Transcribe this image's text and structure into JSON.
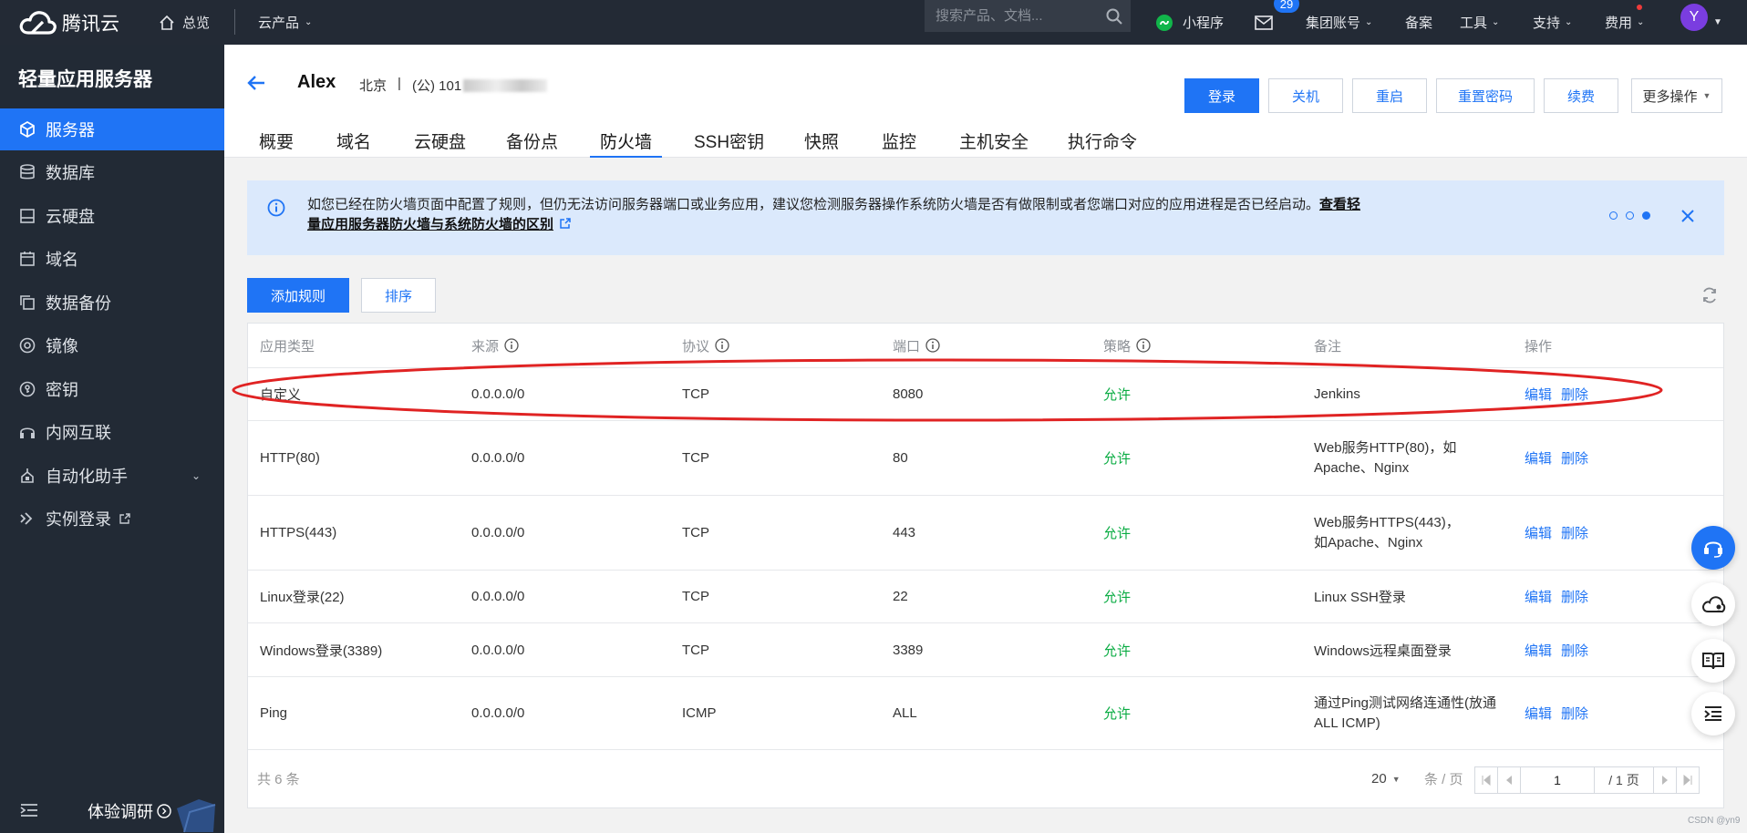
{
  "topbar": {
    "logo": "腾讯云",
    "overview": "总览",
    "products": "云产品",
    "search_placeholder": "搜索产品、文档...",
    "mini_program": "小程序",
    "mail_badge": "29",
    "group_account": "集团账号",
    "filing": "备案",
    "tools": "工具",
    "support": "支持",
    "billing": "费用",
    "avatar": "Y"
  },
  "sidebar": {
    "title": "轻量应用服务器",
    "items": [
      {
        "label": "服务器"
      },
      {
        "label": "数据库"
      },
      {
        "label": "云硬盘"
      },
      {
        "label": "域名"
      },
      {
        "label": "数据备份"
      },
      {
        "label": "镜像"
      },
      {
        "label": "密钥"
      },
      {
        "label": "内网互联"
      },
      {
        "label": "自动化助手"
      },
      {
        "label": "实例登录"
      }
    ],
    "survey": "体验调研"
  },
  "header": {
    "instance_name": "Alex",
    "region": "北京",
    "separator": "|",
    "ip_prefix": "(公) 101",
    "buttons": {
      "login": "登录",
      "shutdown": "关机",
      "restart": "重启",
      "reset_password": "重置密码",
      "renew": "续费",
      "more": "更多操作"
    },
    "tabs": [
      "概要",
      "域名",
      "云硬盘",
      "备份点",
      "防火墙",
      "SSH密钥",
      "快照",
      "监控",
      "主机安全",
      "执行命令"
    ]
  },
  "alert": {
    "text": "如您已经在防火墙页面中配置了规则，但仍无法访问服务器端口或业务应用，建议您检测服务器操作系统防火墙是否有做限制或者您端口对应的应用进程是否已经启动。",
    "link_line1": "查看轻量应用服务器防火墙与系统防火墙的",
    "link_line2": "区别"
  },
  "actions": {
    "add_rule": "添加规则",
    "sort": "排序"
  },
  "table": {
    "columns": [
      "应用类型",
      "来源",
      "协议",
      "端口",
      "策略",
      "备注",
      "操作"
    ],
    "edit": "编辑",
    "delete": "删除",
    "rows": [
      {
        "type": "自定义",
        "source": "0.0.0.0/0",
        "protocol": "TCP",
        "port": "8080",
        "policy": "允许",
        "note": "Jenkins"
      },
      {
        "type": "HTTP(80)",
        "source": "0.0.0.0/0",
        "protocol": "TCP",
        "port": "80",
        "policy": "允许",
        "note": "Web服务HTTP(80)，如Apache、Nginx"
      },
      {
        "type": "HTTPS(443)",
        "source": "0.0.0.0/0",
        "protocol": "TCP",
        "port": "443",
        "policy": "允许",
        "note": "Web服务HTTPS(443)，如Apache、Nginx"
      },
      {
        "type": "Linux登录(22)",
        "source": "0.0.0.0/0",
        "protocol": "TCP",
        "port": "22",
        "policy": "允许",
        "note": "Linux SSH登录"
      },
      {
        "type": "Windows登录(3389)",
        "source": "0.0.0.0/0",
        "protocol": "TCP",
        "port": "3389",
        "policy": "允许",
        "note": "Windows远程桌面登录"
      },
      {
        "type": "Ping",
        "source": "0.0.0.0/0",
        "protocol": "ICMP",
        "port": "ALL",
        "policy": "允许",
        "note": "通过Ping测试网络连通性(放通ALL ICMP)"
      }
    ],
    "total": "共 6 条",
    "page_size": "20",
    "per_page_unit": "条 / 页",
    "page_input": "1",
    "page_total": "/ 1 页"
  },
  "watermark": "CSDN @yn9",
  "colors": {
    "primary": "#1f74f5",
    "topbar_bg": "#232a35",
    "sidebar_bg": "#222a35",
    "allow": "#0aac43",
    "annotation_circle": "#e02323"
  }
}
